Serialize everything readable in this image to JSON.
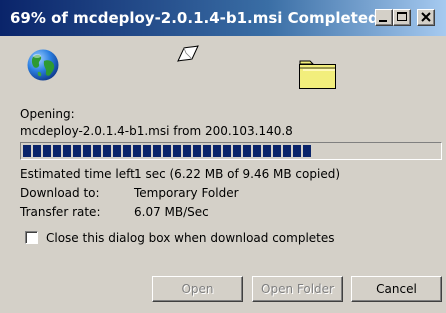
{
  "window": {
    "title": "69% of mcdeploy-2.0.1.4-b1.msi Completed",
    "controls": {
      "minimize_icon": "minimize-icon",
      "maximize_icon": "maximize-icon",
      "close_icon": "close-icon"
    }
  },
  "animation": {
    "source_icon": "globe-icon",
    "transfer_icon": "flying-paper-icon",
    "destination_icon": "folder-icon"
  },
  "status": {
    "opening_label": "Opening:",
    "file_line": "mcdeploy-2.0.1.4-b1.msi from 200.103.140.8"
  },
  "progress": {
    "percent": 69,
    "fill_fraction": 0.69
  },
  "details": {
    "time_left_label": "Estimated time left",
    "time_left_value": "1 sec (6.22 MB of 9.46 MB copied)",
    "download_to_label": "Download to:",
    "download_to_value": "Temporary Folder",
    "transfer_rate_label": "Transfer rate:",
    "transfer_rate_value": "6.07 MB/Sec"
  },
  "checkbox": {
    "label": "Close this dialog box when download completes",
    "checked": false
  },
  "buttons": {
    "open": "Open",
    "open_folder": "Open Folder",
    "cancel": "Cancel"
  },
  "colors": {
    "titlebar_start": "#0a246a",
    "titlebar_end": "#a6caf0",
    "dialog_face": "#d4d0c8",
    "progress_fill": "#0a246a",
    "folder": "#f2ee7c"
  }
}
